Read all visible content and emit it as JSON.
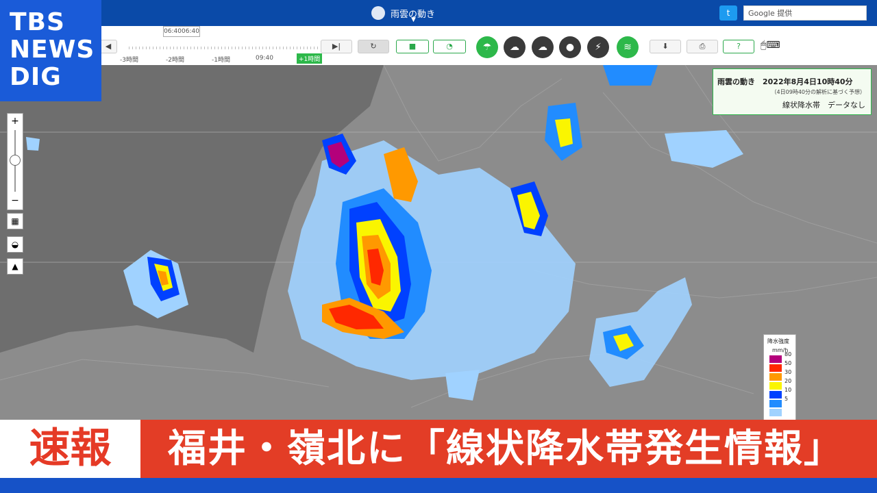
{
  "header": {
    "title": "雨雲の動き",
    "search_placeholder": "Google 提供"
  },
  "toolbar": {
    "time_box": "06:4006:40",
    "time_labels": [
      "-3時間",
      "-2時間",
      "-1時間",
      "09:40"
    ],
    "plus_hour": "+1時間"
  },
  "info": {
    "title": "雨雲の動き　2022年8月4日10時40分",
    "sub": "（4日09時40分の解析に基づく予想）",
    "linear": "線状降水帯　データなし"
  },
  "legend": {
    "title": "降水強度",
    "unit": "mm/h",
    "levels": [
      {
        "value": "80",
        "color": "#b4007b"
      },
      {
        "value": "50",
        "color": "#ff2800"
      },
      {
        "value": "30",
        "color": "#ff9900"
      },
      {
        "value": "20",
        "color": "#faf500"
      },
      {
        "value": "10",
        "color": "#0041ff"
      },
      {
        "value": "5",
        "color": "#218cff"
      },
      {
        "value": "",
        "color": "#a0d2ff"
      }
    ]
  },
  "logo": {
    "line1": "TBS",
    "line2": "NEWS",
    "line3": "DIG"
  },
  "banner": {
    "tag": "速報",
    "headline": "福井・嶺北に「線状降水帯発生情報」"
  }
}
